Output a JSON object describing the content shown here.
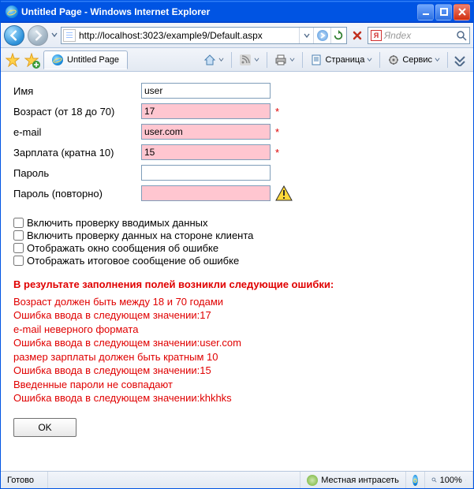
{
  "window": {
    "title": "Untitled Page - Windows Internet Explorer"
  },
  "nav": {
    "url": "http://localhost:3023/example9/Default.aspx",
    "search_placeholder": "Яndex"
  },
  "tab": {
    "label": "Untitled Page"
  },
  "toolbar": {
    "page_label": "Страница",
    "tools_label": "Сервис"
  },
  "form": {
    "name": {
      "label": "Имя",
      "value": "user"
    },
    "age": {
      "label": "Возраст (от 18 до 70)",
      "value": "17"
    },
    "email": {
      "label": "e-mail",
      "value": "user.com"
    },
    "salary": {
      "label": "Зарплата (кратна 10)",
      "value": "15"
    },
    "password": {
      "label": "Пароль",
      "value": ""
    },
    "password2": {
      "label": "Пароль (повторно)",
      "value": ""
    }
  },
  "checks": {
    "c1": "Включить проверку вводимых данных",
    "c2": "Включить проверку данных на стороне клиента",
    "c3": "Отображать окно сообщения об ошибке",
    "c4": "Отображать итоговое сообщение об ошибке"
  },
  "errors": {
    "header": "В результате заполнения полей возникли следующие ошибки:",
    "l1": "Возраст должен быть между 18 и 70 годами",
    "l2": "Ошибка ввода в следующем значении:17",
    "l3": "e-mail неверного формата",
    "l4": "Ошибка ввода в следующем значении:user.com",
    "l5": "размер зарплаты должен быть кратным 10",
    "l6": "Ошибка ввода в следующем значении:15",
    "l7": "Введенные пароли не совпадают",
    "l8": "Ошибка ввода в следующем значении:khkhks"
  },
  "ok_label": "OK",
  "status": {
    "ready": "Готово",
    "zone": "Местная интрасеть",
    "zoom": "100%"
  }
}
